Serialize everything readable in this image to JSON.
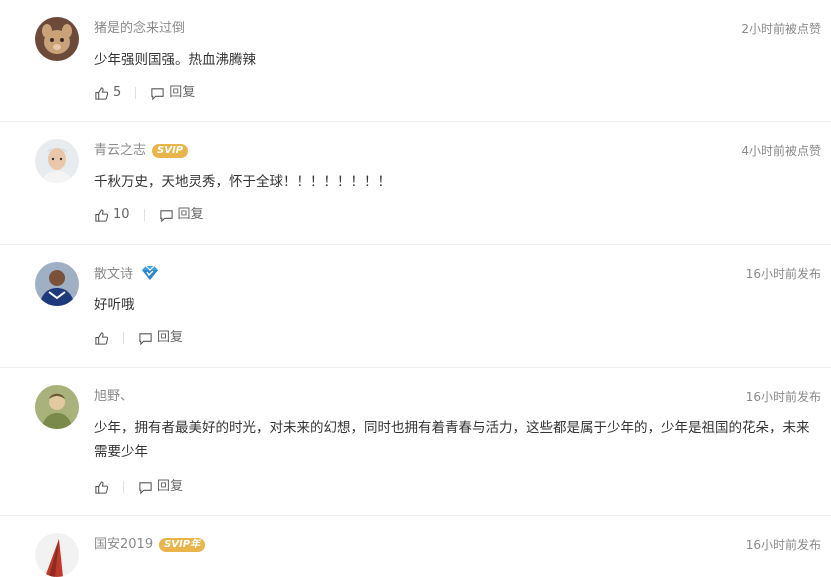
{
  "comments": [
    {
      "username": "猪是的念来过倒",
      "badge": "",
      "time": "2小时前被点赞",
      "content": "少年强则国强。热血沸腾辣",
      "likes": "5",
      "reply_label": "回复",
      "avatar_icon": "cartoon-animal-avatar"
    },
    {
      "username": "青云之志",
      "badge": "SVIP",
      "time": "4小时前被点赞",
      "content": "千秋万史，天地灵秀，怀于全球！！！！！！！！",
      "likes": "10",
      "reply_label": "回复",
      "avatar_icon": "person-photo-avatar"
    },
    {
      "username": "散文诗",
      "badge": "",
      "time": "16小时前发布",
      "content": "好听哦",
      "likes": "",
      "reply_label": "回复",
      "avatar_icon": "athlete-photo-avatar",
      "badge_icon": "diamond-icon"
    },
    {
      "username": "旭野、",
      "badge": "",
      "time": "16小时前发布",
      "content": "少年，拥有者最美好的时光，对未来的幻想，同时也拥有着青春与活力，这些都是属于少年的，少年是祖国的花朵，未来需要少年",
      "likes": "",
      "reply_label": "回复",
      "avatar_icon": "illustrated-avatar"
    },
    {
      "username": "国安2019",
      "badge": "SVIP年",
      "time": "16小时前发布",
      "avatar_icon": "flag-avatar"
    }
  ],
  "colors": {
    "meta_text": "#8a8a8a",
    "content_text": "#333333",
    "svip_badge": "#e9b54a",
    "divider": "#eeeeee"
  }
}
